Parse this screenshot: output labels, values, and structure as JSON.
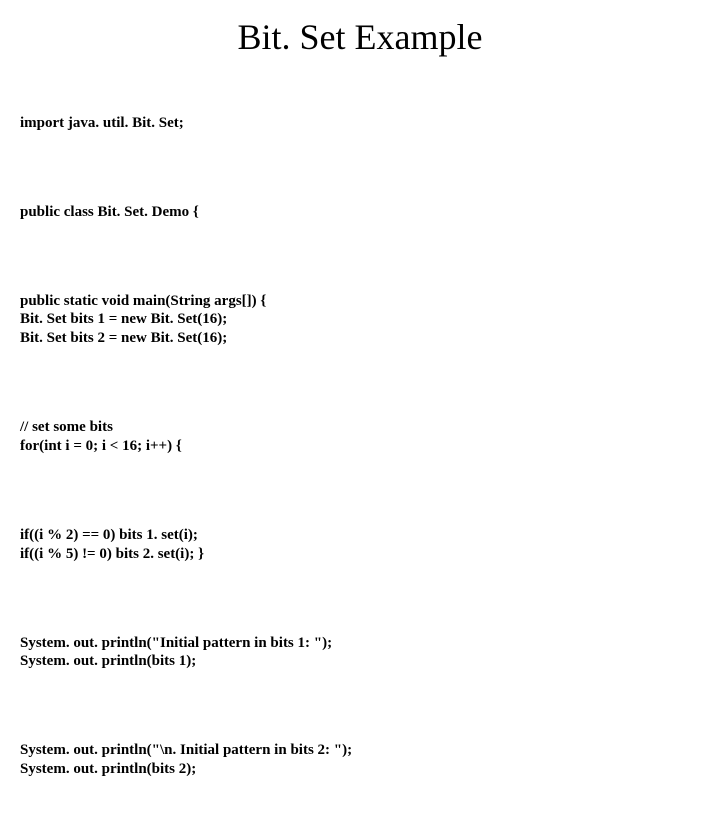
{
  "title": "Bit. Set Example",
  "code": {
    "l1": "import java. util. Bit. Set;",
    "l2": "public class Bit. Set. Demo {",
    "l3a": "public static void main(String args[]) {",
    "l3b": "Bit. Set bits 1 = new Bit. Set(16);",
    "l3c": "Bit. Set bits 2 = new Bit. Set(16);",
    "l4a": "// set some bits",
    "l4b": "for(int i = 0; i < 16; i++) {",
    "l5a": "if((i % 2) == 0) bits 1. set(i);",
    "l5b": "if((i % 5) != 0) bits 2. set(i); }",
    "l6a": "System. out. println(\"Initial pattern in bits 1: \");",
    "l6b": "System. out. println(bits 1);",
    "l7a": "System. out. println(\"\\n. Initial pattern in bits 2: \");",
    "l7b": "System. out. println(bits 2);"
  }
}
